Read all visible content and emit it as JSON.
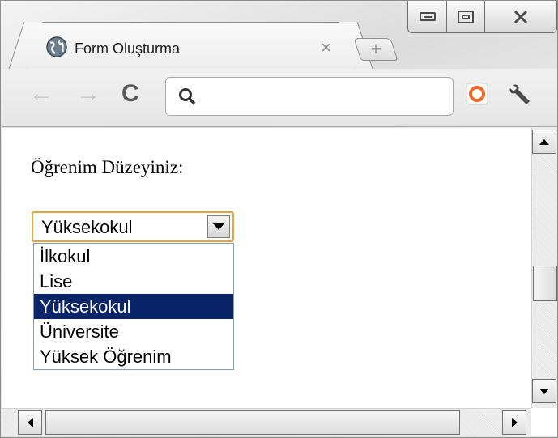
{
  "browser": {
    "tab_title": "Form Oluşturma",
    "tab_close_glyph": "×",
    "new_tab_glyph": "+",
    "back_glyph": "←",
    "forward_glyph": "→",
    "reload_glyph": "C",
    "address_value": "",
    "icons": [
      "page-globe-icon",
      "search-icon",
      "extension-icon",
      "wrench-icon",
      "minimize-icon",
      "maximize-icon",
      "close-icon"
    ]
  },
  "page": {
    "label": "Öğrenim Düzeyiniz:",
    "select": {
      "value": "Yüksekokul",
      "options": [
        "İlkokul",
        "Lise",
        "Yüksekokul",
        "Üniversite",
        "Yüksek Öğrenim"
      ],
      "highlighted": "Yüksekokul"
    }
  },
  "colors": {
    "highlight": "#0a246a",
    "focus_border": "#e2a544"
  }
}
